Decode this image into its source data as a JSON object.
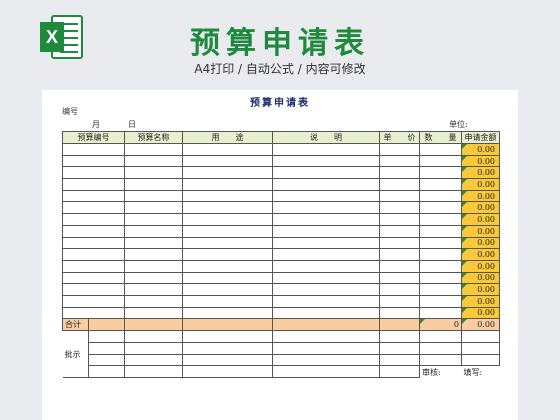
{
  "header": {
    "logo_letter": "X",
    "title": "预算申请表",
    "subtitle": "A4打印 / 自动公式 / 内容可修改"
  },
  "sheet": {
    "title": "预算申请表",
    "number_label": "编号",
    "month_label": "月",
    "day_label": "日",
    "unit_label": "单位:",
    "columns": [
      "预算编号",
      "预算名称",
      "用　　途",
      "说　　明",
      "单　　价",
      "数　　量",
      "申请金额"
    ],
    "row_amount": "0.00",
    "total_label": "合计",
    "total_qty": "0",
    "total_amount": "0.00",
    "approval_label": "批示",
    "reviewer_label": "审核:",
    "filler_label": "填写:"
  },
  "colors": {
    "brand_green": "#1f8a3e",
    "amount_fill": "#f9c93a",
    "total_fill": "#f9cda0",
    "header_fill": "#e7f0cf"
  },
  "icons": {
    "logo": "excel-icon"
  }
}
